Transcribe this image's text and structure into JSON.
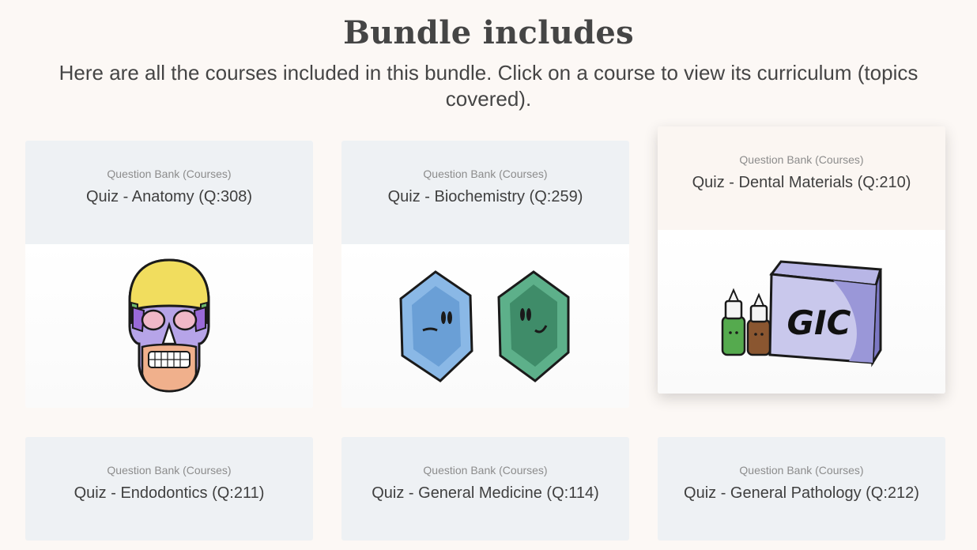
{
  "section": {
    "title": "Bundle includes",
    "subtitle": "Here are all the courses included in this bundle. Click on a course to view its curriculum (topics covered)."
  },
  "courses": [
    {
      "category": "Question Bank (Courses)",
      "title": "Quiz - Anatomy (Q:308)",
      "icon": "skull-icon"
    },
    {
      "category": "Question Bank (Courses)",
      "title": "Quiz - Biochemistry (Q:259)",
      "icon": "hexagon-molecules-icon"
    },
    {
      "category": "Question Bank (Courses)",
      "title": "Quiz - Dental Materials (Q:210)",
      "icon": "gic-box-icon",
      "image_text": "GIC"
    },
    {
      "category": "Question Bank (Courses)",
      "title": "Quiz - Endodontics (Q:211)"
    },
    {
      "category": "Question Bank (Courses)",
      "title": "Quiz - General Medicine (Q:114)"
    },
    {
      "category": "Question Bank (Courses)",
      "title": "Quiz - General Pathology (Q:212)"
    }
  ],
  "colors": {
    "page_background": "#fcf8f5",
    "card_header": "#eef1f4",
    "card_header_hover": "#fbf6f2",
    "text": "#3f3f3f",
    "muted": "#8c8c8c"
  }
}
